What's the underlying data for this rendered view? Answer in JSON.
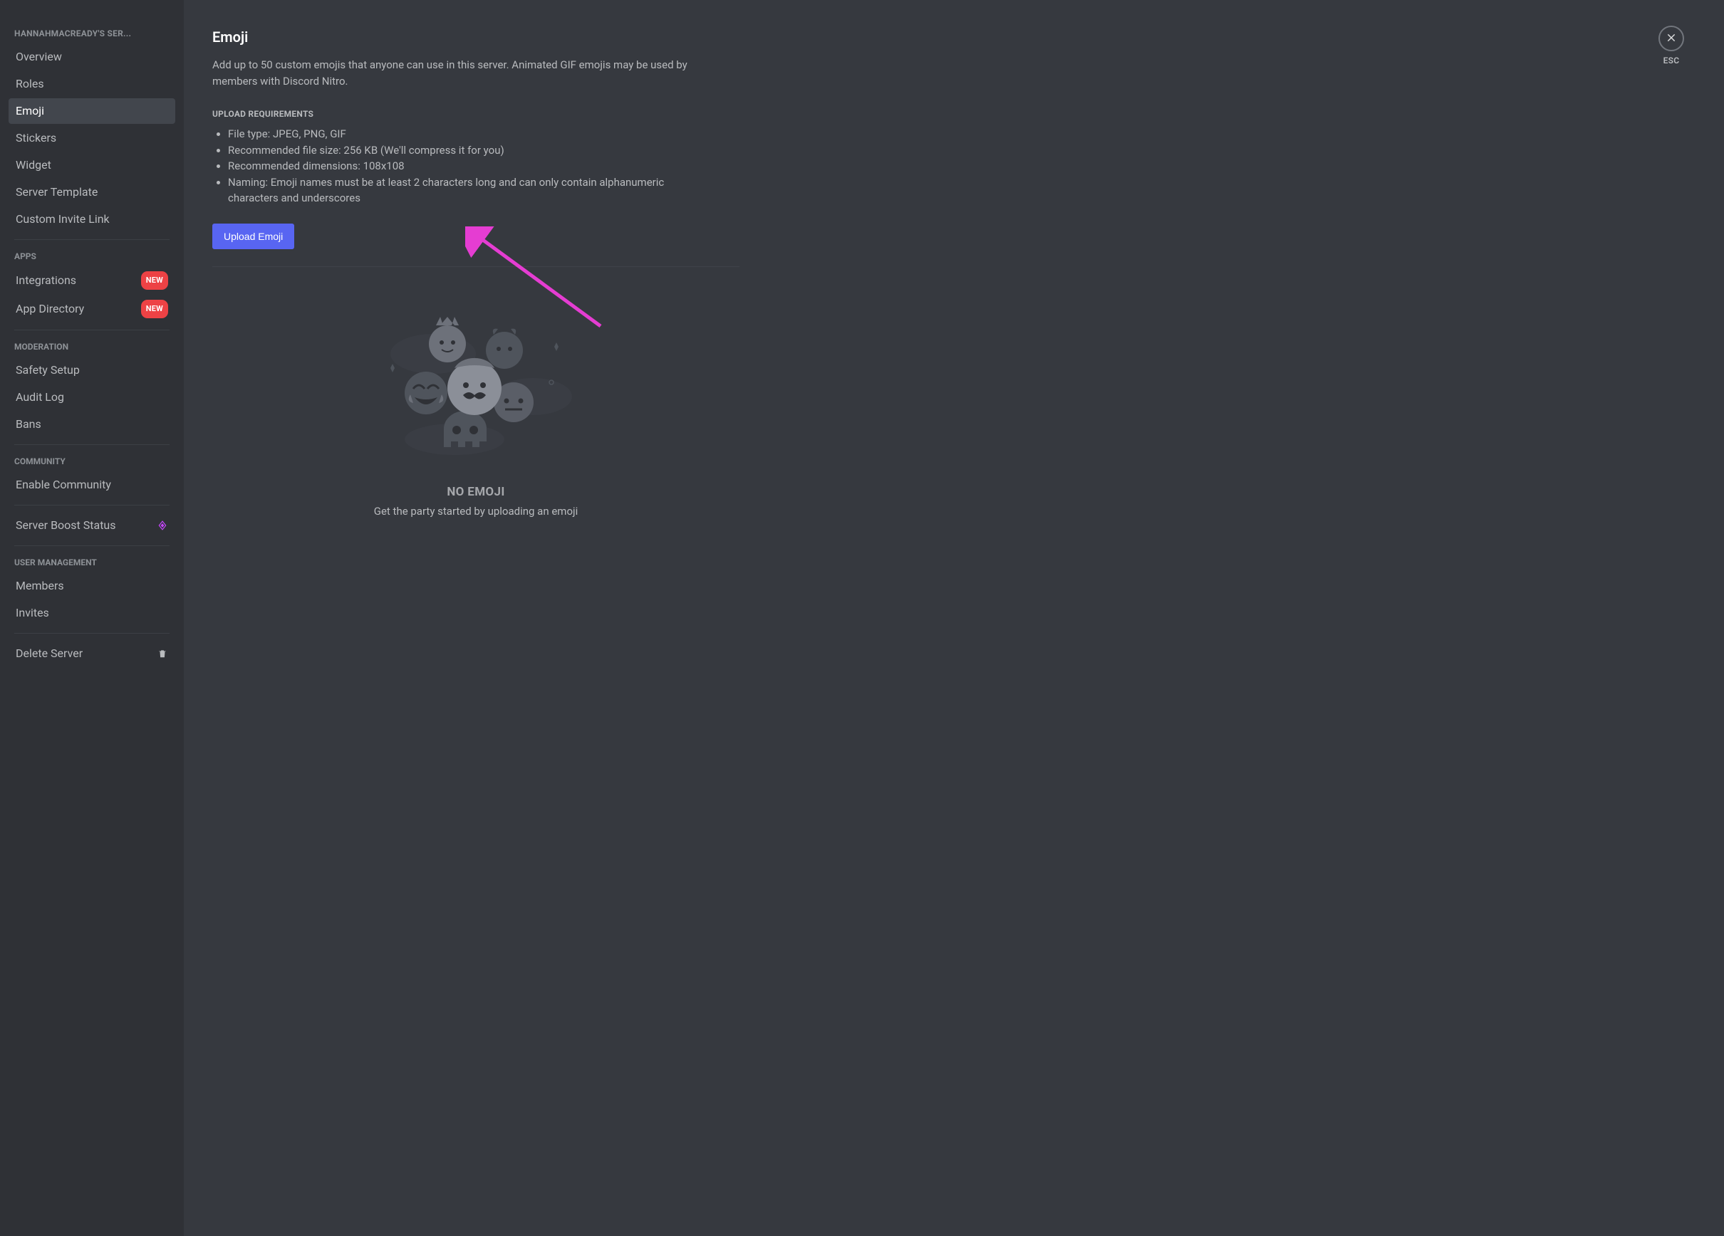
{
  "sidebar": {
    "server_header": "HANNAHMACREADY'S SER...",
    "groups": [
      {
        "header": null,
        "items": [
          {
            "label": "Overview",
            "selected": false
          },
          {
            "label": "Roles",
            "selected": false
          },
          {
            "label": "Emoji",
            "selected": true
          },
          {
            "label": "Stickers",
            "selected": false
          },
          {
            "label": "Widget",
            "selected": false
          },
          {
            "label": "Server Template",
            "selected": false
          },
          {
            "label": "Custom Invite Link",
            "selected": false
          }
        ]
      },
      {
        "header": "APPS",
        "items": [
          {
            "label": "Integrations",
            "badge": "NEW"
          },
          {
            "label": "App Directory",
            "badge": "NEW"
          }
        ]
      },
      {
        "header": "MODERATION",
        "items": [
          {
            "label": "Safety Setup"
          },
          {
            "label": "Audit Log"
          },
          {
            "label": "Bans"
          }
        ]
      },
      {
        "header": "COMMUNITY",
        "items": [
          {
            "label": "Enable Community"
          }
        ]
      },
      {
        "header": null,
        "items": [
          {
            "label": "Server Boost Status",
            "icon": "boost"
          }
        ]
      },
      {
        "header": "USER MANAGEMENT",
        "items": [
          {
            "label": "Members"
          },
          {
            "label": "Invites"
          }
        ]
      },
      {
        "header": null,
        "items": [
          {
            "label": "Delete Server",
            "icon": "trash"
          }
        ]
      }
    ]
  },
  "content": {
    "title": "Emoji",
    "description": "Add up to 50 custom emojis that anyone can use in this server. Animated GIF emojis may be used by members with Discord Nitro.",
    "requirements_header": "UPLOAD REQUIREMENTS",
    "requirements": [
      "File type: JPEG, PNG, GIF",
      "Recommended file size: 256 KB (We'll compress it for you)",
      "Recommended dimensions: 108x108",
      "Naming: Emoji names must be at least 2 characters long and can only contain alphanumeric characters and underscores"
    ],
    "upload_button": "Upload Emoji",
    "empty_title": "NO EMOJI",
    "empty_sub": "Get the party started by uploading an emoji"
  },
  "close": {
    "esc": "ESC"
  },
  "colors": {
    "accent": "#5865f2",
    "badge_red": "#ed4245",
    "boost_pink": "#c847ff",
    "annotation": "#e53dd2"
  }
}
